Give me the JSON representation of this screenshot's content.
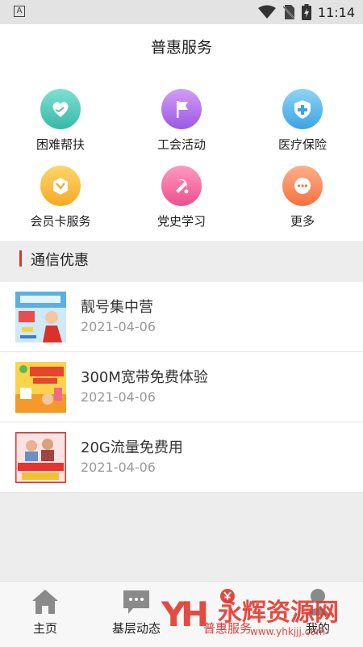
{
  "status_bar": {
    "left_badge": "A",
    "time": "11:14"
  },
  "header": {
    "title": "普惠服务"
  },
  "services": [
    {
      "label": "困难帮扶",
      "icon": "heart-hands-icon",
      "color_top": "#7fe0d4",
      "color_bottom": "#36b8a8"
    },
    {
      "label": "工会活动",
      "icon": "flag-icon",
      "color_top": "#d59cf5",
      "color_bottom": "#9a58e3"
    },
    {
      "label": "医疗保险",
      "icon": "medical-shield-icon",
      "color_top": "#8fd4f5",
      "color_bottom": "#3aa4e5"
    },
    {
      "label": "会员卡服务",
      "icon": "member-card-icon",
      "color_top": "#ffd56b",
      "color_bottom": "#f6aa24"
    },
    {
      "label": "党史学习",
      "icon": "party-emblem-icon",
      "color_top": "#ff9ac0",
      "color_bottom": "#ee4f8c"
    },
    {
      "label": "更多",
      "icon": "more-dots-icon",
      "color_top": "#ffb08a",
      "color_bottom": "#f7713f"
    }
  ],
  "section": {
    "title": "通信优惠",
    "accent": "#d23a2a"
  },
  "news": [
    {
      "title": "靓号集中营",
      "date": "2021-04-06",
      "thumb": "blue-promo-thumb"
    },
    {
      "title": "300M宽带免费体验",
      "date": "2021-04-06",
      "thumb": "yellow-promo-thumb"
    },
    {
      "title": "20G流量免费用",
      "date": "2021-04-06",
      "thumb": "red-promo-thumb"
    }
  ],
  "bottom_nav": [
    {
      "label": "主页",
      "icon": "home-icon"
    },
    {
      "label": "基层动态",
      "icon": "chat-bubble-icon"
    },
    {
      "label": "普惠服务",
      "icon": "service-yen-icon",
      "active": true
    },
    {
      "label": "我的",
      "icon": "profile-icon"
    }
  ],
  "watermark": {
    "brand": "永辉资源网",
    "url": "www.yhkjjj.com"
  }
}
